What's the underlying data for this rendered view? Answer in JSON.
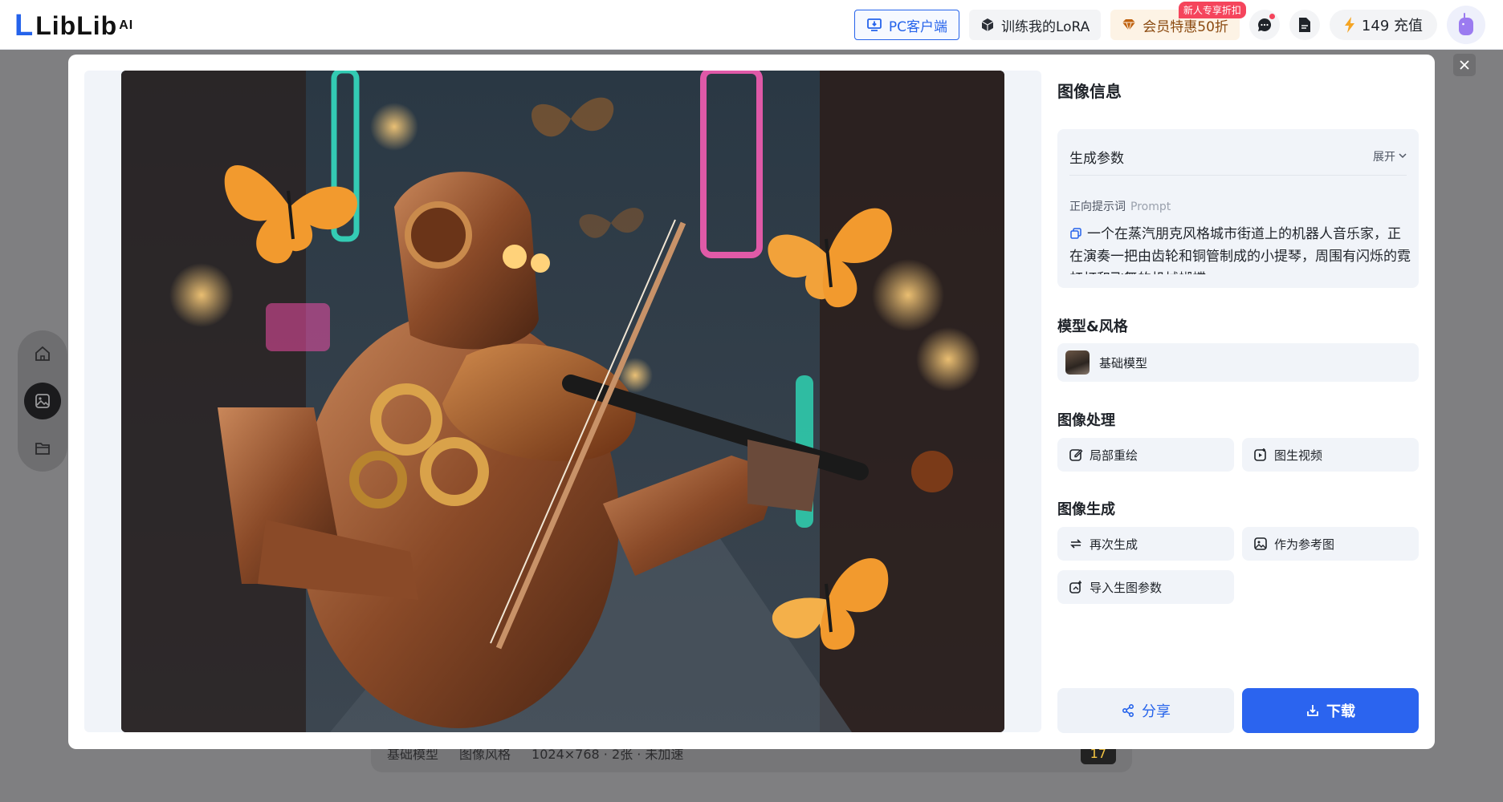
{
  "header": {
    "logo_text": "LibLib",
    "logo_sup": "AI",
    "pc_client_label": "PC客户端",
    "train_lora_label": "训练我的LoRA",
    "vip_label": "会员特惠50折",
    "vip_tag": "新人专享折扣",
    "credits_label": "149 充值"
  },
  "background_bar": {
    "model": "基础模型",
    "style": "图像风格",
    "size_info": "1024×768 · 2张 · 未加速",
    "cost": "17"
  },
  "panel": {
    "title": "图像信息",
    "params_title": "生成参数",
    "expand_label": "展开",
    "prompt_label": "正向提示词",
    "prompt_label_en": "Prompt",
    "prompt_text": "一个在蒸汽朋克风格城市街道上的机器人音乐家，正在演奏一把由齿轮和铜管制成的小提琴，周围有闪烁的霓虹灯和飞舞的机械蝴蝶",
    "model_section": "模型&风格",
    "model_name": "基础模型",
    "process_section": "图像处理",
    "inpaint_label": "局部重绘",
    "img2video_label": "图生视频",
    "generate_section": "图像生成",
    "regen_label": "再次生成",
    "as_ref_label": "作为参考图",
    "import_params_label": "导入生图参数",
    "share_label": "分享",
    "download_label": "下载"
  },
  "colors": {
    "accent": "#2b64ef",
    "panel_bg": "#f1f4f9",
    "vip_bg": "#fdf3e5",
    "badge_red": "#f5455c"
  }
}
